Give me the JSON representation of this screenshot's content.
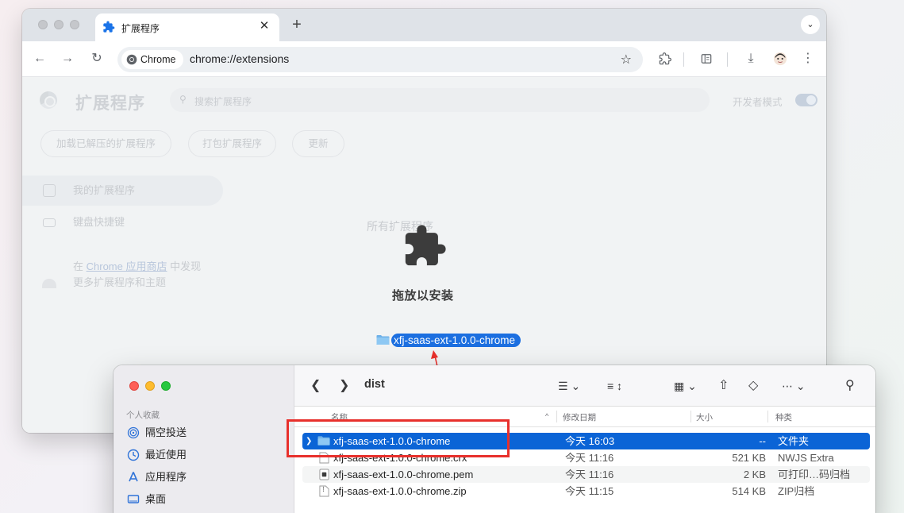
{
  "chrome": {
    "tab_title": "扩展程序",
    "new_tab_symbol": "+",
    "close_symbol": "✕",
    "site_chip": "Chrome",
    "url": "chrome://extensions",
    "page": {
      "title": "扩展程序",
      "search_placeholder": "搜索扩展程序",
      "developer_mode_label": "开发者模式",
      "developer_mode_on": true,
      "buttons": [
        "加载已解压的扩展程序",
        "打包扩展程序",
        "更新"
      ],
      "sidebar": {
        "items": [
          "我的扩展程序",
          "键盘快捷键"
        ],
        "promo_prefix": "在 ",
        "promo_link": "Chrome 应用商店",
        "promo_suffix": " 中发现",
        "promo_line2": "更多扩展程序和主题"
      },
      "section_title": "所有扩展程序",
      "drop_label": "拖放以安装"
    }
  },
  "drag_item": {
    "label": "xfj-saas-ext-1.0.0-chrome"
  },
  "finder": {
    "path": "dist",
    "sidebar_section": "个人收藏",
    "sidebar_items": [
      {
        "label": "隔空投送",
        "icon": "airdrop-icon"
      },
      {
        "label": "最近使用",
        "icon": "clock-icon"
      },
      {
        "label": "应用程序",
        "icon": "applications-icon"
      },
      {
        "label": "桌面",
        "icon": "desktop-icon"
      }
    ],
    "columns": {
      "name": "名称",
      "date": "修改日期",
      "size": "大小",
      "kind": "种类"
    },
    "rows": [
      {
        "name": "xfj-saas-ext-1.0.0-chrome",
        "date": "今天 16:03",
        "size": "--",
        "kind": "文件夹",
        "icon": "folder-icon",
        "selected": true
      },
      {
        "name": "xfj-saas-ext-1.0.0-chrome.crx",
        "date": "今天 11:16",
        "size": "521 KB",
        "kind": "NWJS Extra",
        "icon": "file-icon",
        "selected": false
      },
      {
        "name": "xfj-saas-ext-1.0.0-chrome.pem",
        "date": "今天 11:16",
        "size": "2 KB",
        "kind": "可打印…码归档",
        "icon": "pem-file-icon",
        "selected": false
      },
      {
        "name": "xfj-saas-ext-1.0.0-chrome.zip",
        "date": "今天 11:15",
        "size": "514 KB",
        "kind": "ZIP归档",
        "icon": "zip-file-icon",
        "selected": false
      }
    ]
  },
  "annotation": {
    "highlight_color": "#e8302c",
    "selection_color": "#0b64d6"
  }
}
